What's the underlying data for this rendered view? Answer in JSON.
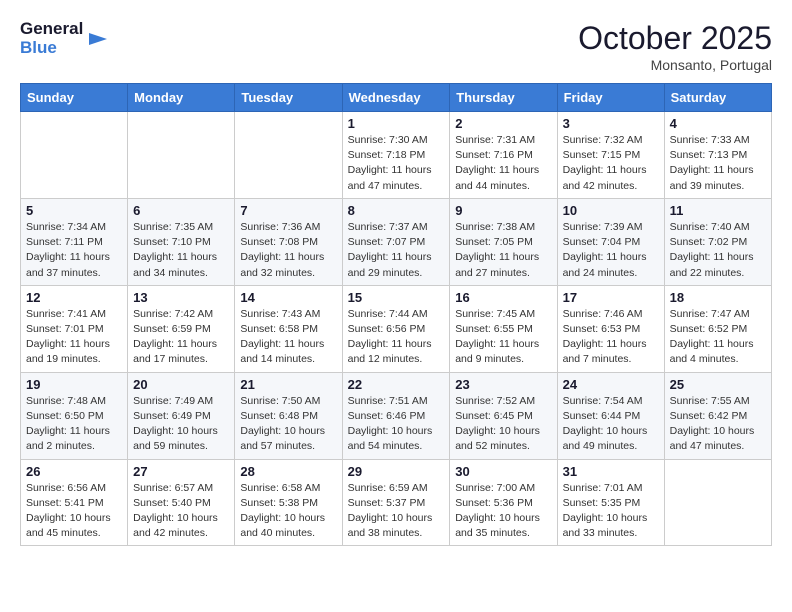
{
  "header": {
    "logo_line1": "General",
    "logo_line2": "Blue",
    "month_title": "October 2025",
    "subtitle": "Monsanto, Portugal"
  },
  "weekdays": [
    "Sunday",
    "Monday",
    "Tuesday",
    "Wednesday",
    "Thursday",
    "Friday",
    "Saturday"
  ],
  "weeks": [
    [
      {
        "day": "",
        "info": ""
      },
      {
        "day": "",
        "info": ""
      },
      {
        "day": "",
        "info": ""
      },
      {
        "day": "1",
        "info": "Sunrise: 7:30 AM\nSunset: 7:18 PM\nDaylight: 11 hours\nand 47 minutes."
      },
      {
        "day": "2",
        "info": "Sunrise: 7:31 AM\nSunset: 7:16 PM\nDaylight: 11 hours\nand 44 minutes."
      },
      {
        "day": "3",
        "info": "Sunrise: 7:32 AM\nSunset: 7:15 PM\nDaylight: 11 hours\nand 42 minutes."
      },
      {
        "day": "4",
        "info": "Sunrise: 7:33 AM\nSunset: 7:13 PM\nDaylight: 11 hours\nand 39 minutes."
      }
    ],
    [
      {
        "day": "5",
        "info": "Sunrise: 7:34 AM\nSunset: 7:11 PM\nDaylight: 11 hours\nand 37 minutes."
      },
      {
        "day": "6",
        "info": "Sunrise: 7:35 AM\nSunset: 7:10 PM\nDaylight: 11 hours\nand 34 minutes."
      },
      {
        "day": "7",
        "info": "Sunrise: 7:36 AM\nSunset: 7:08 PM\nDaylight: 11 hours\nand 32 minutes."
      },
      {
        "day": "8",
        "info": "Sunrise: 7:37 AM\nSunset: 7:07 PM\nDaylight: 11 hours\nand 29 minutes."
      },
      {
        "day": "9",
        "info": "Sunrise: 7:38 AM\nSunset: 7:05 PM\nDaylight: 11 hours\nand 27 minutes."
      },
      {
        "day": "10",
        "info": "Sunrise: 7:39 AM\nSunset: 7:04 PM\nDaylight: 11 hours\nand 24 minutes."
      },
      {
        "day": "11",
        "info": "Sunrise: 7:40 AM\nSunset: 7:02 PM\nDaylight: 11 hours\nand 22 minutes."
      }
    ],
    [
      {
        "day": "12",
        "info": "Sunrise: 7:41 AM\nSunset: 7:01 PM\nDaylight: 11 hours\nand 19 minutes."
      },
      {
        "day": "13",
        "info": "Sunrise: 7:42 AM\nSunset: 6:59 PM\nDaylight: 11 hours\nand 17 minutes."
      },
      {
        "day": "14",
        "info": "Sunrise: 7:43 AM\nSunset: 6:58 PM\nDaylight: 11 hours\nand 14 minutes."
      },
      {
        "day": "15",
        "info": "Sunrise: 7:44 AM\nSunset: 6:56 PM\nDaylight: 11 hours\nand 12 minutes."
      },
      {
        "day": "16",
        "info": "Sunrise: 7:45 AM\nSunset: 6:55 PM\nDaylight: 11 hours\nand 9 minutes."
      },
      {
        "day": "17",
        "info": "Sunrise: 7:46 AM\nSunset: 6:53 PM\nDaylight: 11 hours\nand 7 minutes."
      },
      {
        "day": "18",
        "info": "Sunrise: 7:47 AM\nSunset: 6:52 PM\nDaylight: 11 hours\nand 4 minutes."
      }
    ],
    [
      {
        "day": "19",
        "info": "Sunrise: 7:48 AM\nSunset: 6:50 PM\nDaylight: 11 hours\nand 2 minutes."
      },
      {
        "day": "20",
        "info": "Sunrise: 7:49 AM\nSunset: 6:49 PM\nDaylight: 10 hours\nand 59 minutes."
      },
      {
        "day": "21",
        "info": "Sunrise: 7:50 AM\nSunset: 6:48 PM\nDaylight: 10 hours\nand 57 minutes."
      },
      {
        "day": "22",
        "info": "Sunrise: 7:51 AM\nSunset: 6:46 PM\nDaylight: 10 hours\nand 54 minutes."
      },
      {
        "day": "23",
        "info": "Sunrise: 7:52 AM\nSunset: 6:45 PM\nDaylight: 10 hours\nand 52 minutes."
      },
      {
        "day": "24",
        "info": "Sunrise: 7:54 AM\nSunset: 6:44 PM\nDaylight: 10 hours\nand 49 minutes."
      },
      {
        "day": "25",
        "info": "Sunrise: 7:55 AM\nSunset: 6:42 PM\nDaylight: 10 hours\nand 47 minutes."
      }
    ],
    [
      {
        "day": "26",
        "info": "Sunrise: 6:56 AM\nSunset: 5:41 PM\nDaylight: 10 hours\nand 45 minutes."
      },
      {
        "day": "27",
        "info": "Sunrise: 6:57 AM\nSunset: 5:40 PM\nDaylight: 10 hours\nand 42 minutes."
      },
      {
        "day": "28",
        "info": "Sunrise: 6:58 AM\nSunset: 5:38 PM\nDaylight: 10 hours\nand 40 minutes."
      },
      {
        "day": "29",
        "info": "Sunrise: 6:59 AM\nSunset: 5:37 PM\nDaylight: 10 hours\nand 38 minutes."
      },
      {
        "day": "30",
        "info": "Sunrise: 7:00 AM\nSunset: 5:36 PM\nDaylight: 10 hours\nand 35 minutes."
      },
      {
        "day": "31",
        "info": "Sunrise: 7:01 AM\nSunset: 5:35 PM\nDaylight: 10 hours\nand 33 minutes."
      },
      {
        "day": "",
        "info": ""
      }
    ]
  ]
}
